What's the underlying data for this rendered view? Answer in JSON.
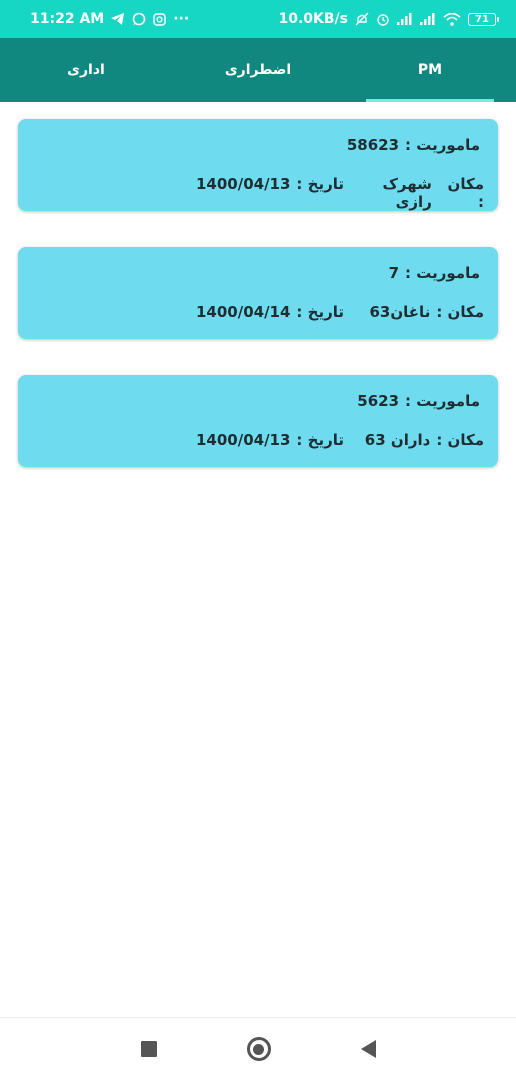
{
  "status_bar": {
    "time": "11:22 AM",
    "net_speed": "10.0KB/s",
    "battery": "71",
    "more": "···",
    "icons": [
      "telegram-icon",
      "whatsapp-icon",
      "instagram-icon",
      "mute-icon",
      "alarm-icon",
      "signal-icon",
      "signal-icon",
      "wifi-icon",
      "battery-icon"
    ]
  },
  "tabs": [
    {
      "label": "اداری",
      "active": false
    },
    {
      "label": "اضطراری",
      "active": false
    },
    {
      "label": "PM",
      "active": true
    }
  ],
  "missions": [
    {
      "mission_label": "ماموریت :",
      "mission_no": "58623",
      "location_label": "مکان :",
      "location": "شهرک رازی",
      "date_label": "تاریخ :",
      "date": "1400/04/13"
    },
    {
      "mission_label": "ماموریت :",
      "mission_no": "7",
      "location_label": "مکان :",
      "location": "ناغان63",
      "date_label": "تاریخ :",
      "date": "1400/04/14"
    },
    {
      "mission_label": "ماموریت :",
      "mission_no": "5623",
      "location_label": "مکان :",
      "location": "داران 63",
      "date_label": "تاریخ :",
      "date": "1400/04/13"
    }
  ],
  "colors": {
    "status_bar": "#16d6c4",
    "tab_bar": "#108880",
    "card": "#6fdbee",
    "tab_indicator": "#7fe6dc"
  }
}
